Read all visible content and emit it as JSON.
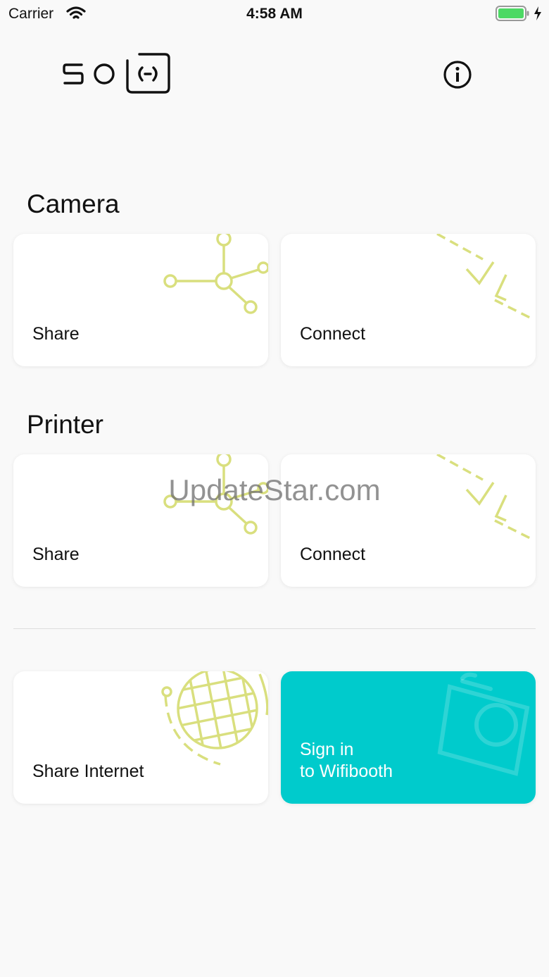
{
  "status_bar": {
    "carrier": "Carrier",
    "time": "4:58 AM"
  },
  "header": {
    "logo_icon": "solo-logo",
    "info_icon": "info-icon"
  },
  "sections": {
    "camera": {
      "title": "Camera",
      "share_label": "Share",
      "connect_label": "Connect"
    },
    "printer": {
      "title": "Printer",
      "share_label": "Share",
      "connect_label": "Connect"
    }
  },
  "bottom": {
    "share_internet_label": "Share Internet",
    "sign_in_label": "Sign in\nto Wifibooth"
  },
  "watermark": "UpdateStar.com",
  "colors": {
    "accent_lime": "#d9df7e",
    "teal": "#00cbcc",
    "background": "#f9f9f9",
    "battery_green": "#4cd964"
  }
}
